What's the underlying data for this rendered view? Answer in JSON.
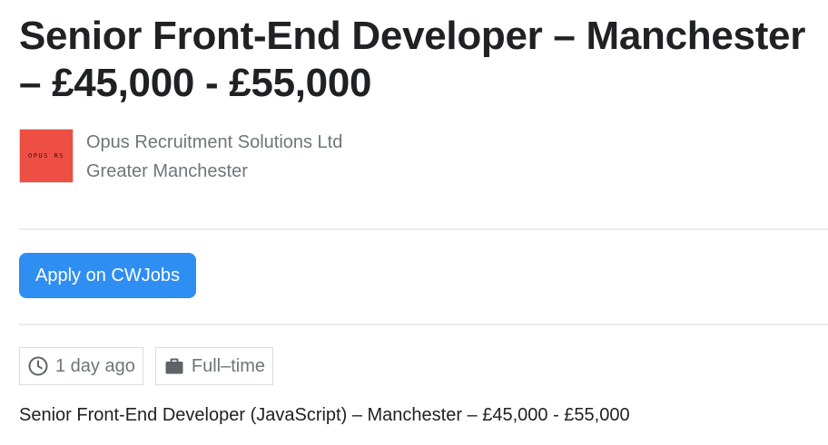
{
  "job": {
    "title": "Senior Front-End Developer – Manchester – £45,000 - £55,000",
    "company": "Opus Recruitment Solutions Ltd",
    "location": "Greater Manchester",
    "logo_text": "OPUS RS",
    "apply_label": "Apply on CWJobs",
    "posted": "1 day ago",
    "employment_type": "Full–time",
    "description": "Senior Front-End Developer (JavaScript) – Manchester – £45,000 - £55,000"
  },
  "icons": {
    "posted": "clock-icon",
    "employment_type": "briefcase-icon"
  },
  "colors": {
    "apply_button": "#2f8ef2",
    "logo_background": "#ee4f45",
    "muted_text": "#70757a",
    "title_text": "#202124"
  }
}
